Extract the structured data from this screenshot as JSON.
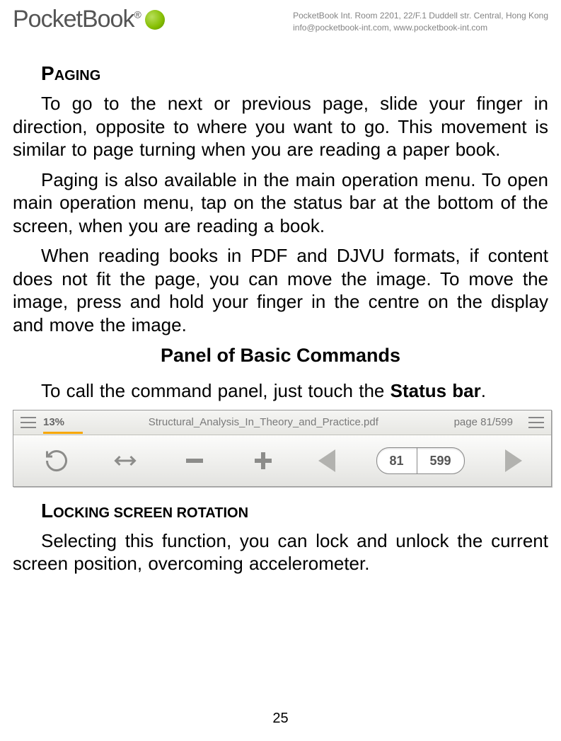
{
  "header": {
    "brand_pocket": "Pocket",
    "brand_book": "Book",
    "brand_reg": "®",
    "company_line1": "PocketBook Int. Room 2201, 22/F.1 Duddell str. Central, Hong Kong",
    "company_line2": "info@pocketbook-int.com, www.pocketbook-int.com"
  },
  "sections": {
    "paging_heading": "Paging",
    "paging_p1": "To go to the next or previous page, slide your finger in direction, opposite to where you want to go. This movement is similar to page turning when you are reading a paper book.",
    "paging_p2": "Paging is also available in the main operation menu. To open main operation menu, tap on the status bar at the bottom of the screen, when you are reading a book.",
    "paging_p3": "When reading books in PDF and DJVU formats, if content does not fit the page, you can move the image. To move the image, press and hold your finger in the centre on the display and move the image.",
    "panel_title": "Panel of Basic Commands",
    "panel_intro_prefix": "To call the command panel, just touch the ",
    "panel_intro_bold": "Status bar",
    "panel_intro_suffix": ".",
    "locking_heading": "Locking screen rotation",
    "locking_p1": "Selecting this function, you can lock and unlock the current screen position, overcoming accelerometer."
  },
  "panel_ui": {
    "percent": "13%",
    "filename": "Structural_Analysis_In_Theory_and_Practice.pdf",
    "page_indicator": "page 81/599",
    "current_page": "81",
    "total_pages": "599"
  },
  "footer": {
    "page_num": "25"
  }
}
